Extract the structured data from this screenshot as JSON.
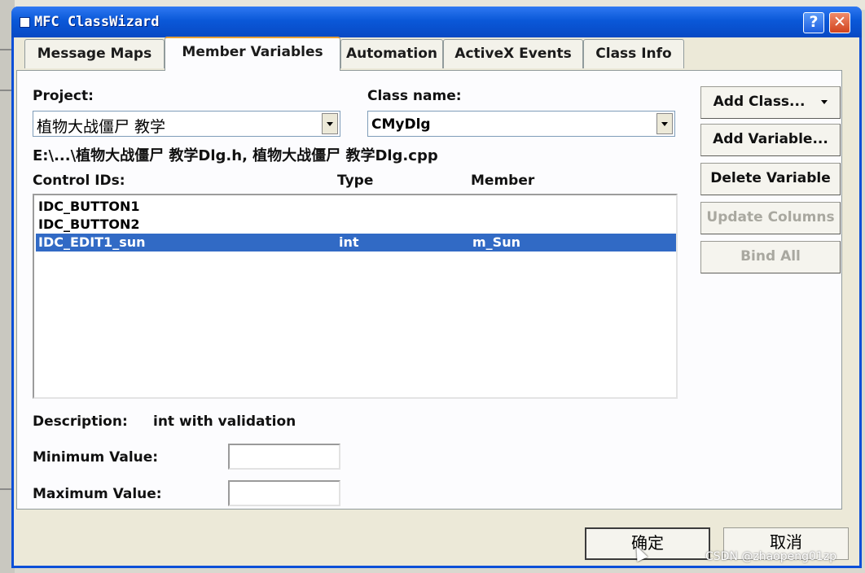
{
  "window": {
    "title": "MFC ClassWizard",
    "help_glyph": "?",
    "close_glyph": "✕"
  },
  "tabs": [
    {
      "label": "Message Maps"
    },
    {
      "label": "Member Variables"
    },
    {
      "label": "Automation"
    },
    {
      "label": "ActiveX Events"
    },
    {
      "label": "Class Info"
    }
  ],
  "project": {
    "label": "Project:",
    "value": "植物大战僵尸 教学"
  },
  "class_name": {
    "label": "Class name:",
    "value": "CMyDlg"
  },
  "files_path": "E:\\...\\植物大战僵尸 教学Dlg.h, 植物大战僵尸 教学Dlg.cpp",
  "columns": {
    "control_ids": "Control IDs:",
    "type": "Type",
    "member": "Member"
  },
  "rows": [
    {
      "id": "IDC_BUTTON1",
      "type": "",
      "member": ""
    },
    {
      "id": "IDC_BUTTON2",
      "type": "",
      "member": ""
    },
    {
      "id": "IDC_EDIT1_sun",
      "type": "int",
      "member": "m_Sun"
    }
  ],
  "buttons": {
    "add_class": "Add Class...",
    "add_variable": "Add Variable...",
    "delete_variable": "Delete Variable",
    "update_columns": "Update Columns",
    "bind_all": "Bind All"
  },
  "description": {
    "label": "Description:",
    "value": "int with validation"
  },
  "minimum": {
    "label": "Minimum Value:",
    "value": ""
  },
  "maximum": {
    "label": "Maximum Value:",
    "value": ""
  },
  "footer": {
    "ok": "确定",
    "cancel": "取消"
  },
  "watermark": "CSDN @zhaopeng01zp",
  "colors": {
    "titlebar": "#0a58d8",
    "selection": "#316ac5",
    "tab_active_accent": "#e7a23a"
  }
}
